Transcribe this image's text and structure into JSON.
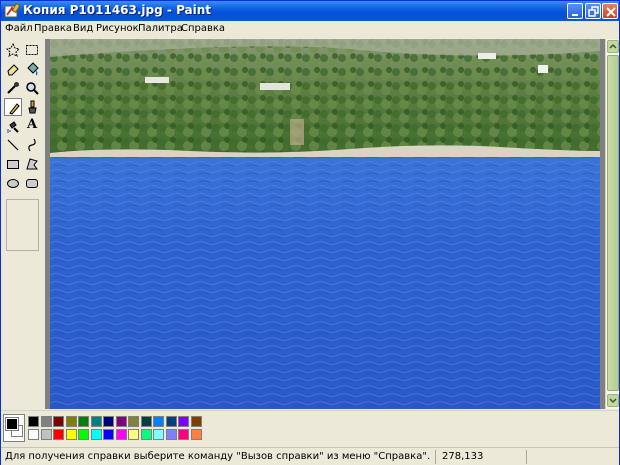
{
  "window": {
    "title": "Копия P1011463.jpg - Paint",
    "buttons": {
      "minimize": "minimize-icon",
      "maximize": "maximize-icon",
      "close": "close-icon"
    }
  },
  "menu": {
    "items": [
      "Файл",
      "Правка",
      "Вид",
      "Рисунок",
      "Палитра",
      "Справка"
    ]
  },
  "toolbox": {
    "tools": [
      {
        "name": "free-select-tool",
        "icon": "star-select-icon"
      },
      {
        "name": "rect-select-tool",
        "icon": "rect-select-icon"
      },
      {
        "name": "eraser-tool",
        "icon": "eraser-icon"
      },
      {
        "name": "fill-tool",
        "icon": "bucket-icon"
      },
      {
        "name": "pick-color-tool",
        "icon": "eyedropper-icon"
      },
      {
        "name": "magnifier-tool",
        "icon": "magnifier-icon"
      },
      {
        "name": "pencil-tool",
        "icon": "pencil-icon",
        "active": true
      },
      {
        "name": "brush-tool",
        "icon": "brush-icon"
      },
      {
        "name": "airbrush-tool",
        "icon": "airbrush-icon"
      },
      {
        "name": "text-tool",
        "icon": "text-icon",
        "glyph": "A"
      },
      {
        "name": "line-tool",
        "icon": "line-icon"
      },
      {
        "name": "curve-tool",
        "icon": "curve-icon"
      },
      {
        "name": "rectangle-tool",
        "icon": "rectangle-icon"
      },
      {
        "name": "polygon-tool",
        "icon": "polygon-icon"
      },
      {
        "name": "ellipse-tool",
        "icon": "ellipse-icon"
      },
      {
        "name": "rounded-rect-tool",
        "icon": "rounded-rect-icon"
      }
    ]
  },
  "palette": {
    "foreground": "#000000",
    "background": "#ffffff",
    "row1": [
      "#000000",
      "#808080",
      "#800000",
      "#808000",
      "#008000",
      "#008080",
      "#000080",
      "#800080",
      "#808040",
      "#004040",
      "#0080ff",
      "#004080",
      "#8000ff",
      "#804000"
    ],
    "row2": [
      "#ffffff",
      "#c0c0c0",
      "#ff0000",
      "#ffff00",
      "#00ff00",
      "#00ffff",
      "#0000ff",
      "#ff00ff",
      "#ffff80",
      "#00ff80",
      "#80ffff",
      "#8080ff",
      "#ff0080",
      "#ff8040"
    ]
  },
  "status": {
    "help_text": "Для получения справки выберите команду \"Вызов справки\" из меню \"Справка\".",
    "coords": "278,133"
  },
  "colors": {
    "title_bar": "#0a5fe0",
    "sea": "#2f62d0",
    "hill": "#4f7a3a"
  }
}
